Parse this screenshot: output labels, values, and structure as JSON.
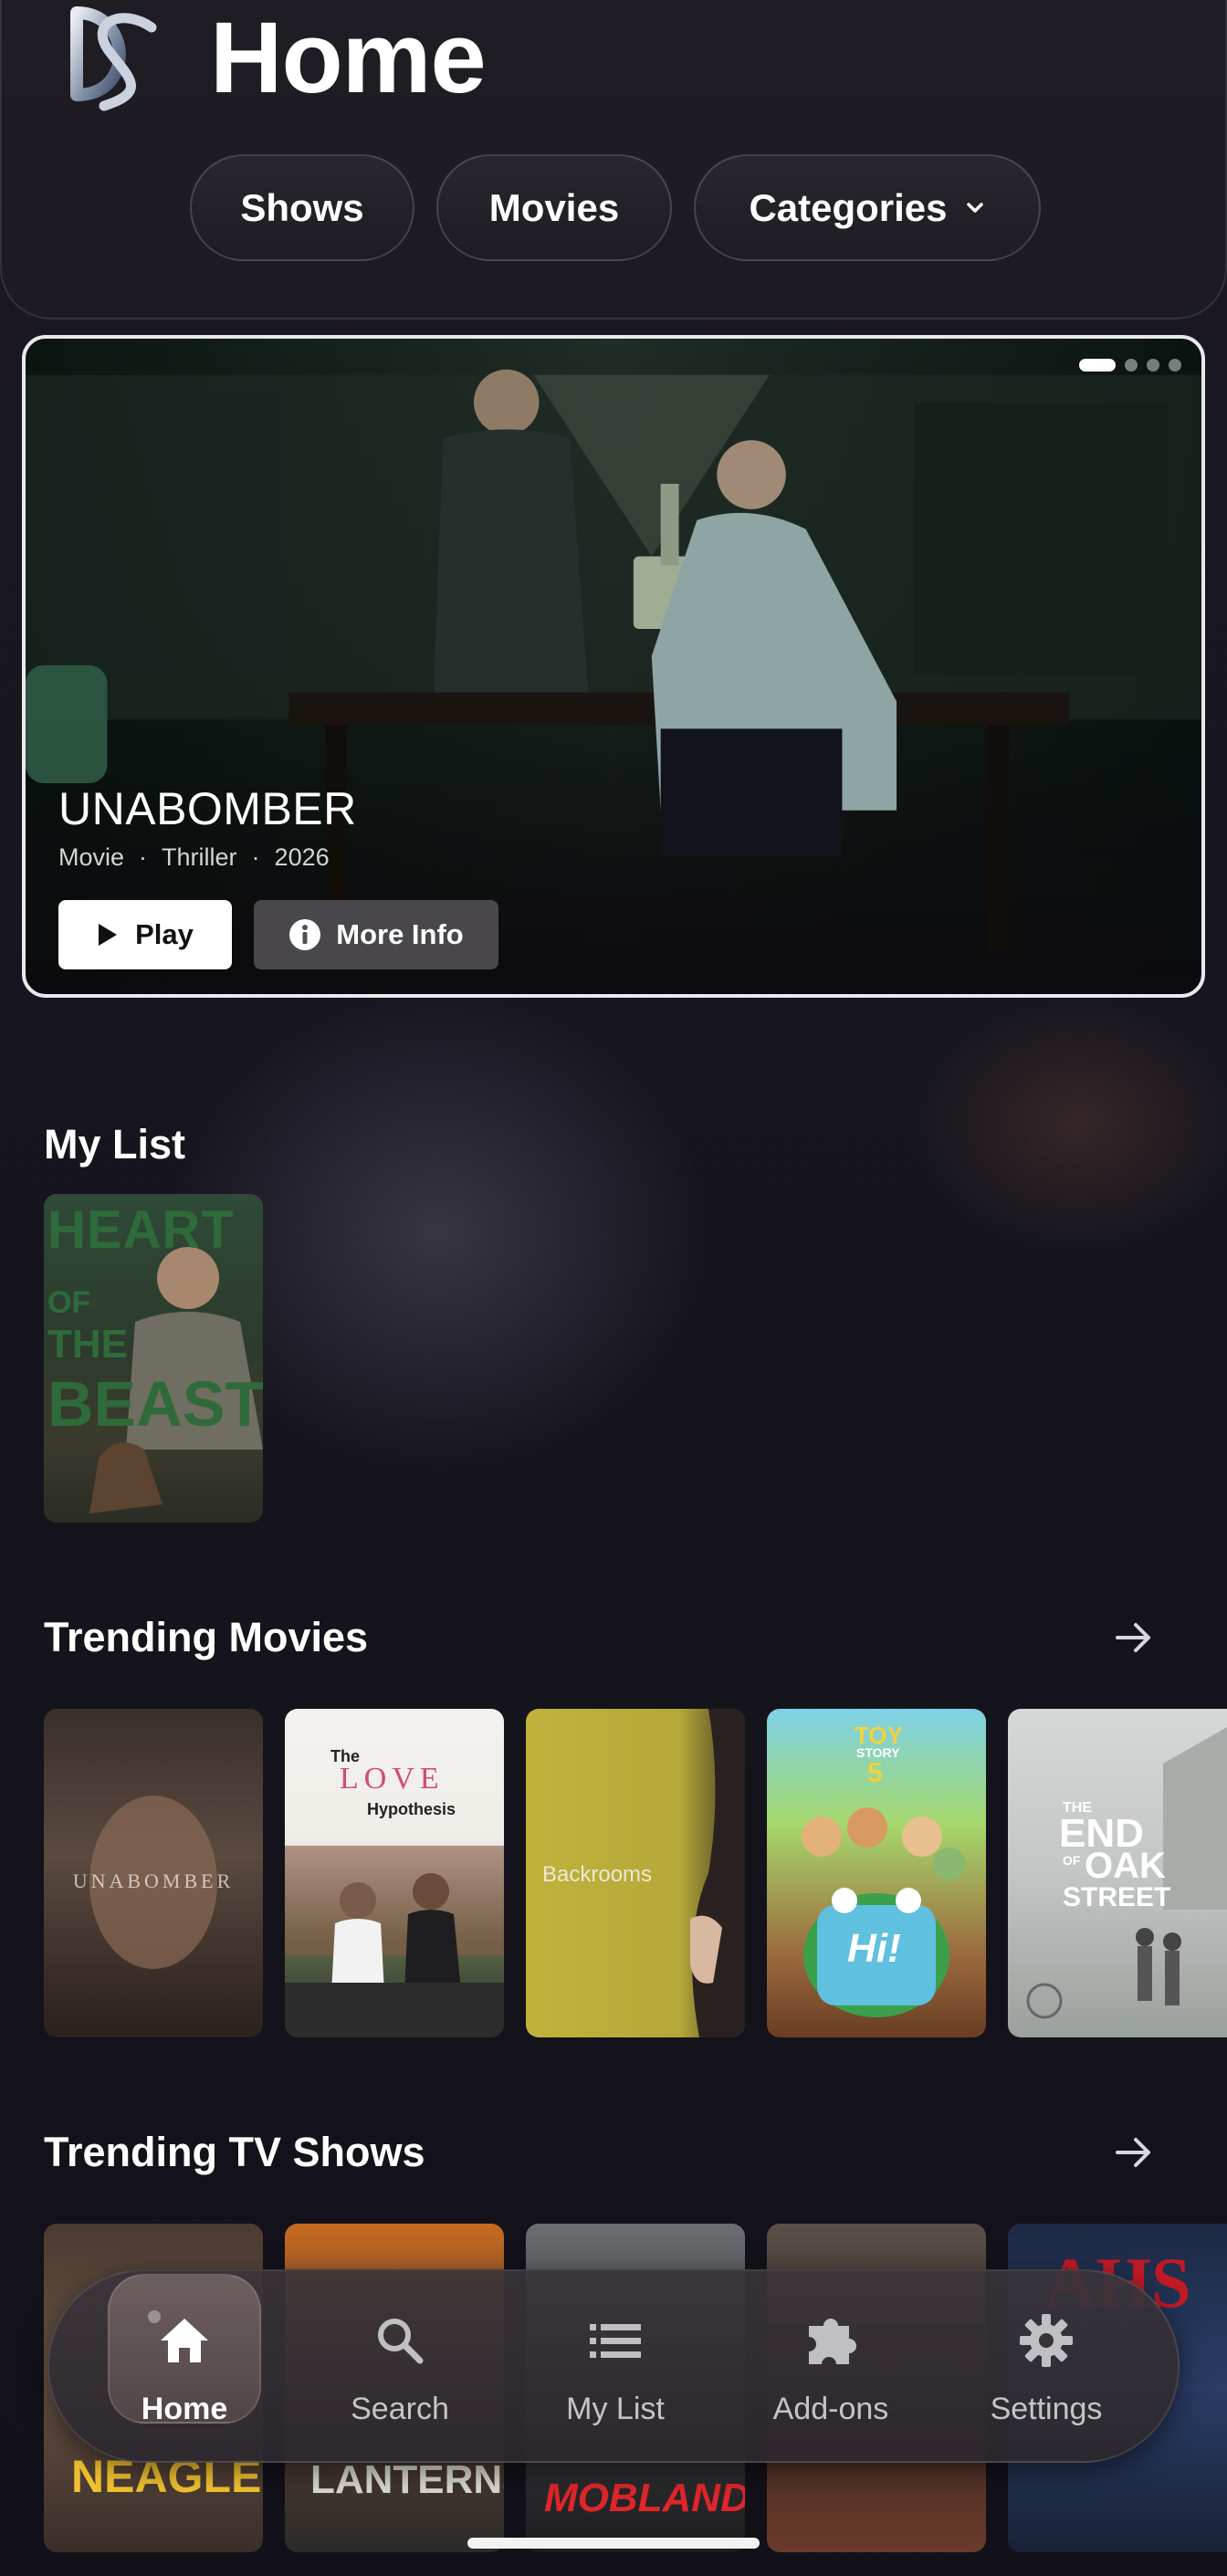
{
  "header": {
    "title": "Home",
    "logo_icon": "ds-logo-icon",
    "nav": [
      {
        "label": "Shows"
      },
      {
        "label": "Movies"
      },
      {
        "label": "Categories",
        "icon": "chevron-down-icon"
      }
    ]
  },
  "hero": {
    "title": "UNABOMBER",
    "meta": [
      "Movie",
      "·",
      "Thriller",
      "·",
      "2026"
    ],
    "play_label": "Play",
    "info_label": "More Info",
    "carousel": {
      "count": 4,
      "active_index": 0
    }
  },
  "my_list": {
    "title": "My List",
    "items": [
      {
        "poster_text": [
          "HEART",
          "OF",
          "THE",
          "BEAST"
        ]
      }
    ]
  },
  "trending_movies": {
    "title": "Trending Movies",
    "items": [
      {
        "poster_text": "UNABOMBER"
      },
      {
        "poster_text": [
          "The",
          "LOVE",
          "Hypothesis"
        ]
      },
      {
        "poster_text": "Backrooms"
      },
      {
        "poster_text": [
          "TOY",
          "STORY",
          "5",
          "Hi!"
        ]
      },
      {
        "poster_text": [
          "THE",
          "END",
          "OF",
          "OAK",
          "STREET"
        ]
      }
    ]
  },
  "trending_tv": {
    "title": "Trending TV Shows",
    "items": [
      {
        "poster_text": "NEAGLEY"
      },
      {
        "poster_text": "LANTERNS"
      },
      {
        "poster_text": "MOBLAND"
      },
      {
        "poster_text": ""
      },
      {
        "poster_text": "AHS"
      }
    ]
  },
  "bottom_nav": {
    "items": [
      {
        "label": "Home",
        "icon": "home-icon",
        "active": true
      },
      {
        "label": "Search",
        "icon": "search-icon",
        "active": false
      },
      {
        "label": "My List",
        "icon": "list-icon",
        "active": false
      },
      {
        "label": "Add-ons",
        "icon": "puzzle-icon",
        "active": false
      },
      {
        "label": "Settings",
        "icon": "gear-icon",
        "active": false
      }
    ]
  },
  "colors": {
    "background": "#18161f",
    "accent": "#ffffff",
    "hero_border": "#e9e9ee"
  }
}
